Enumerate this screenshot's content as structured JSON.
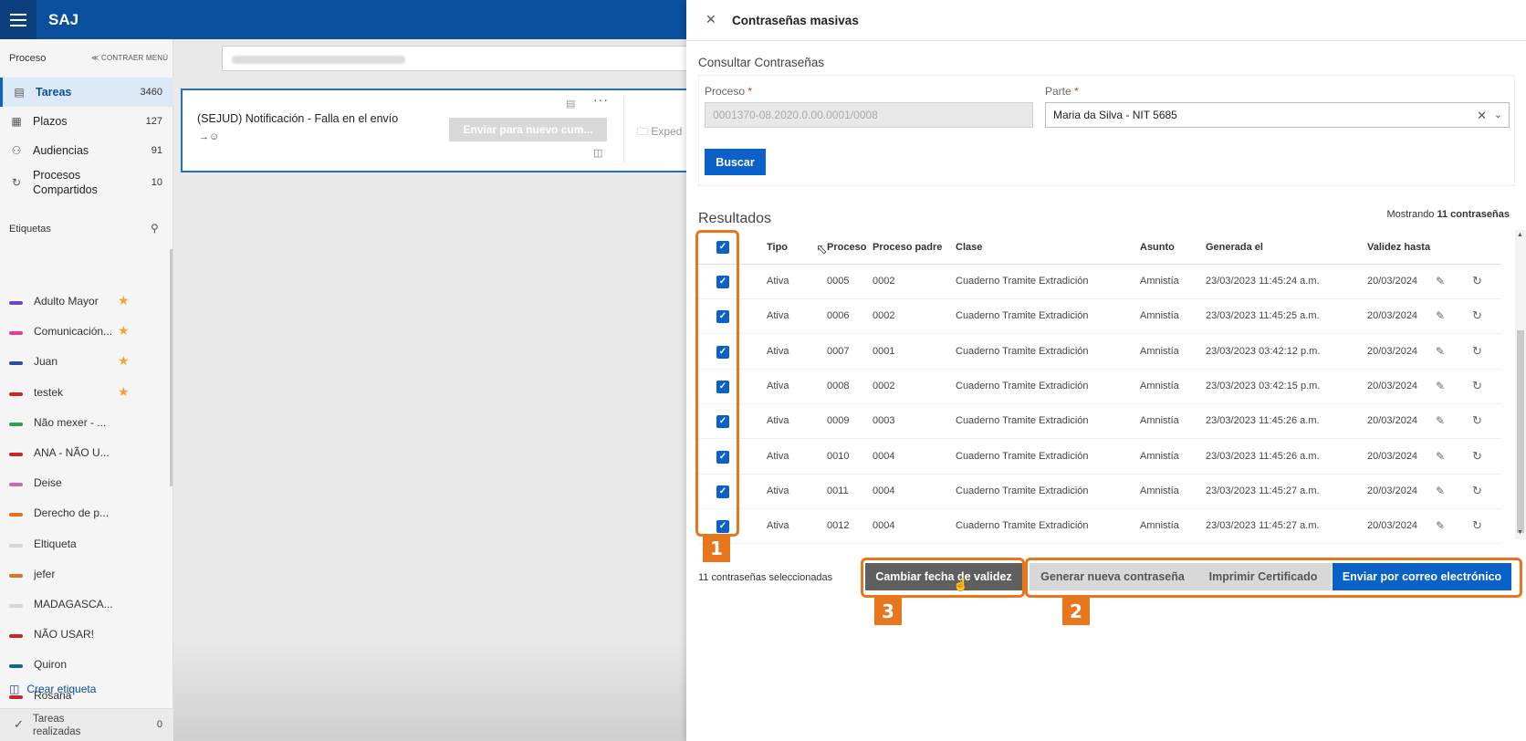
{
  "app": {
    "name": "SAJ"
  },
  "sidebar": {
    "heading": "Proceso",
    "collapse_label": "≪ CONTRAER MENÚ",
    "nav": [
      {
        "label": "Tareas",
        "count": "3460",
        "icon": "tasks-icon"
      },
      {
        "label": "Plazos",
        "count": "127",
        "icon": "calendar-icon"
      },
      {
        "label": "Audiencias",
        "count": "91",
        "icon": "people-icon"
      },
      {
        "label": "Procesos Compartidos",
        "count": "10",
        "icon": "share-icon"
      }
    ],
    "tags_heading": "Etiquetas",
    "tags": [
      {
        "label": "Adulto Mayor",
        "color": "#6c49b8",
        "starred": true
      },
      {
        "label": "Comunicación...",
        "color": "#e83e8c",
        "starred": true
      },
      {
        "label": "Juan",
        "color": "#2a4f9e",
        "starred": true
      },
      {
        "label": "testek",
        "color": "#c62828",
        "starred": true
      },
      {
        "label": "Não mexer - ...",
        "color": "#2e9e4f",
        "starred": false
      },
      {
        "label": "ANA - NÃO U...",
        "color": "#c62828",
        "starred": false
      },
      {
        "label": "Deise",
        "color": "#c76ab7",
        "starred": false
      },
      {
        "label": "Derecho de p...",
        "color": "#e07028",
        "starred": false
      },
      {
        "label": "Eltiqueta",
        "color": "#d6d6d6",
        "starred": false
      },
      {
        "label": "jefer",
        "color": "#e07028",
        "starred": false
      },
      {
        "label": "MADAGASCA...",
        "color": "#d6d6d6",
        "starred": false
      },
      {
        "label": "NÃO USAR!",
        "color": "#c62828",
        "starred": false
      },
      {
        "label": "Quiron",
        "color": "#0f6e76",
        "starred": false
      },
      {
        "label": "Rosana",
        "color": "#c62828",
        "starred": false
      }
    ],
    "create_tag": "Crear etiqueta",
    "done_tasks": {
      "label": "Tareas realizadas",
      "count": "0"
    }
  },
  "task_card": {
    "title": "(SEJUD) Notificación - Falla en el envío",
    "button": "Enviar para nuevo cum...",
    "folder": "Exped"
  },
  "panel": {
    "title": "Contraseñas masivas",
    "section": "Consultar Contraseñas",
    "proceso_label": "Proceso",
    "proceso_value": "0001370-08.2020.0.00.0001/0008",
    "parte_label": "Parte",
    "parte_value": "Maria da Silva - NIT 5685",
    "required_mark": "*",
    "search_button": "Buscar",
    "results_title": "Resultados",
    "results_prefix": "Mostrando",
    "results_count": "11 contraseñas",
    "columns": [
      "Tipo",
      "Proceso",
      "Proceso padre",
      "Clase",
      "Asunto",
      "Generada el",
      "Validez hasta"
    ],
    "rows": [
      {
        "tipo": "Ativa",
        "proceso": "0005",
        "padre": "0002",
        "clase": "Cuaderno Tramite Extradición",
        "asunto": "Amnistía",
        "generada": "23/03/2023 11:45:24 a.m.",
        "validez": "20/03/2024"
      },
      {
        "tipo": "Ativa",
        "proceso": "0006",
        "padre": "0002",
        "clase": "Cuaderno Tramite Extradición",
        "asunto": "Amnistía",
        "generada": "23/03/2023 11:45:25 a.m.",
        "validez": "20/03/2024"
      },
      {
        "tipo": "Ativa",
        "proceso": "0007",
        "padre": "0001",
        "clase": "Cuaderno Tramite Extradición",
        "asunto": "Amnistía",
        "generada": "23/03/2023 03:42:12 p.m.",
        "validez": "20/03/2024"
      },
      {
        "tipo": "Ativa",
        "proceso": "0008",
        "padre": "0002",
        "clase": "Cuaderno Tramite Extradición",
        "asunto": "Amnistía",
        "generada": "23/03/2023 03:42:15 p.m.",
        "validez": "20/03/2024"
      },
      {
        "tipo": "Ativa",
        "proceso": "0009",
        "padre": "0003",
        "clase": "Cuaderno Tramite Extradición",
        "asunto": "Amnistía",
        "generada": "23/03/2023 11:45:26 a.m.",
        "validez": "20/03/2024"
      },
      {
        "tipo": "Ativa",
        "proceso": "0010",
        "padre": "0004",
        "clase": "Cuaderno Tramite Extradición",
        "asunto": "Amnistía",
        "generada": "23/03/2023 11:45:26 a.m.",
        "validez": "20/03/2024"
      },
      {
        "tipo": "Ativa",
        "proceso": "0011",
        "padre": "0004",
        "clase": "Cuaderno Tramite Extradición",
        "asunto": "Amnistía",
        "generada": "23/03/2023 11:45:27 a.m.",
        "validez": "20/03/2024"
      },
      {
        "tipo": "Ativa",
        "proceso": "0012",
        "padre": "0004",
        "clase": "Cuaderno Tramite Extradición",
        "asunto": "Amnistía",
        "generada": "23/03/2023 11:45:27 a.m.",
        "validez": "20/03/2024"
      }
    ],
    "selected_text": "11 contraseñas seleccionadas",
    "actions": {
      "change_date": "Cambiar fecha de validez",
      "generate": "Generar nueva contraseña",
      "print": "Imprimir Certificado",
      "email": "Enviar por correo electrónico"
    }
  },
  "annotations": [
    "1",
    "2",
    "3"
  ],
  "colors": {
    "primary": "#0a62c9",
    "header": "#0a4f9e",
    "annotation": "#e8761d"
  }
}
